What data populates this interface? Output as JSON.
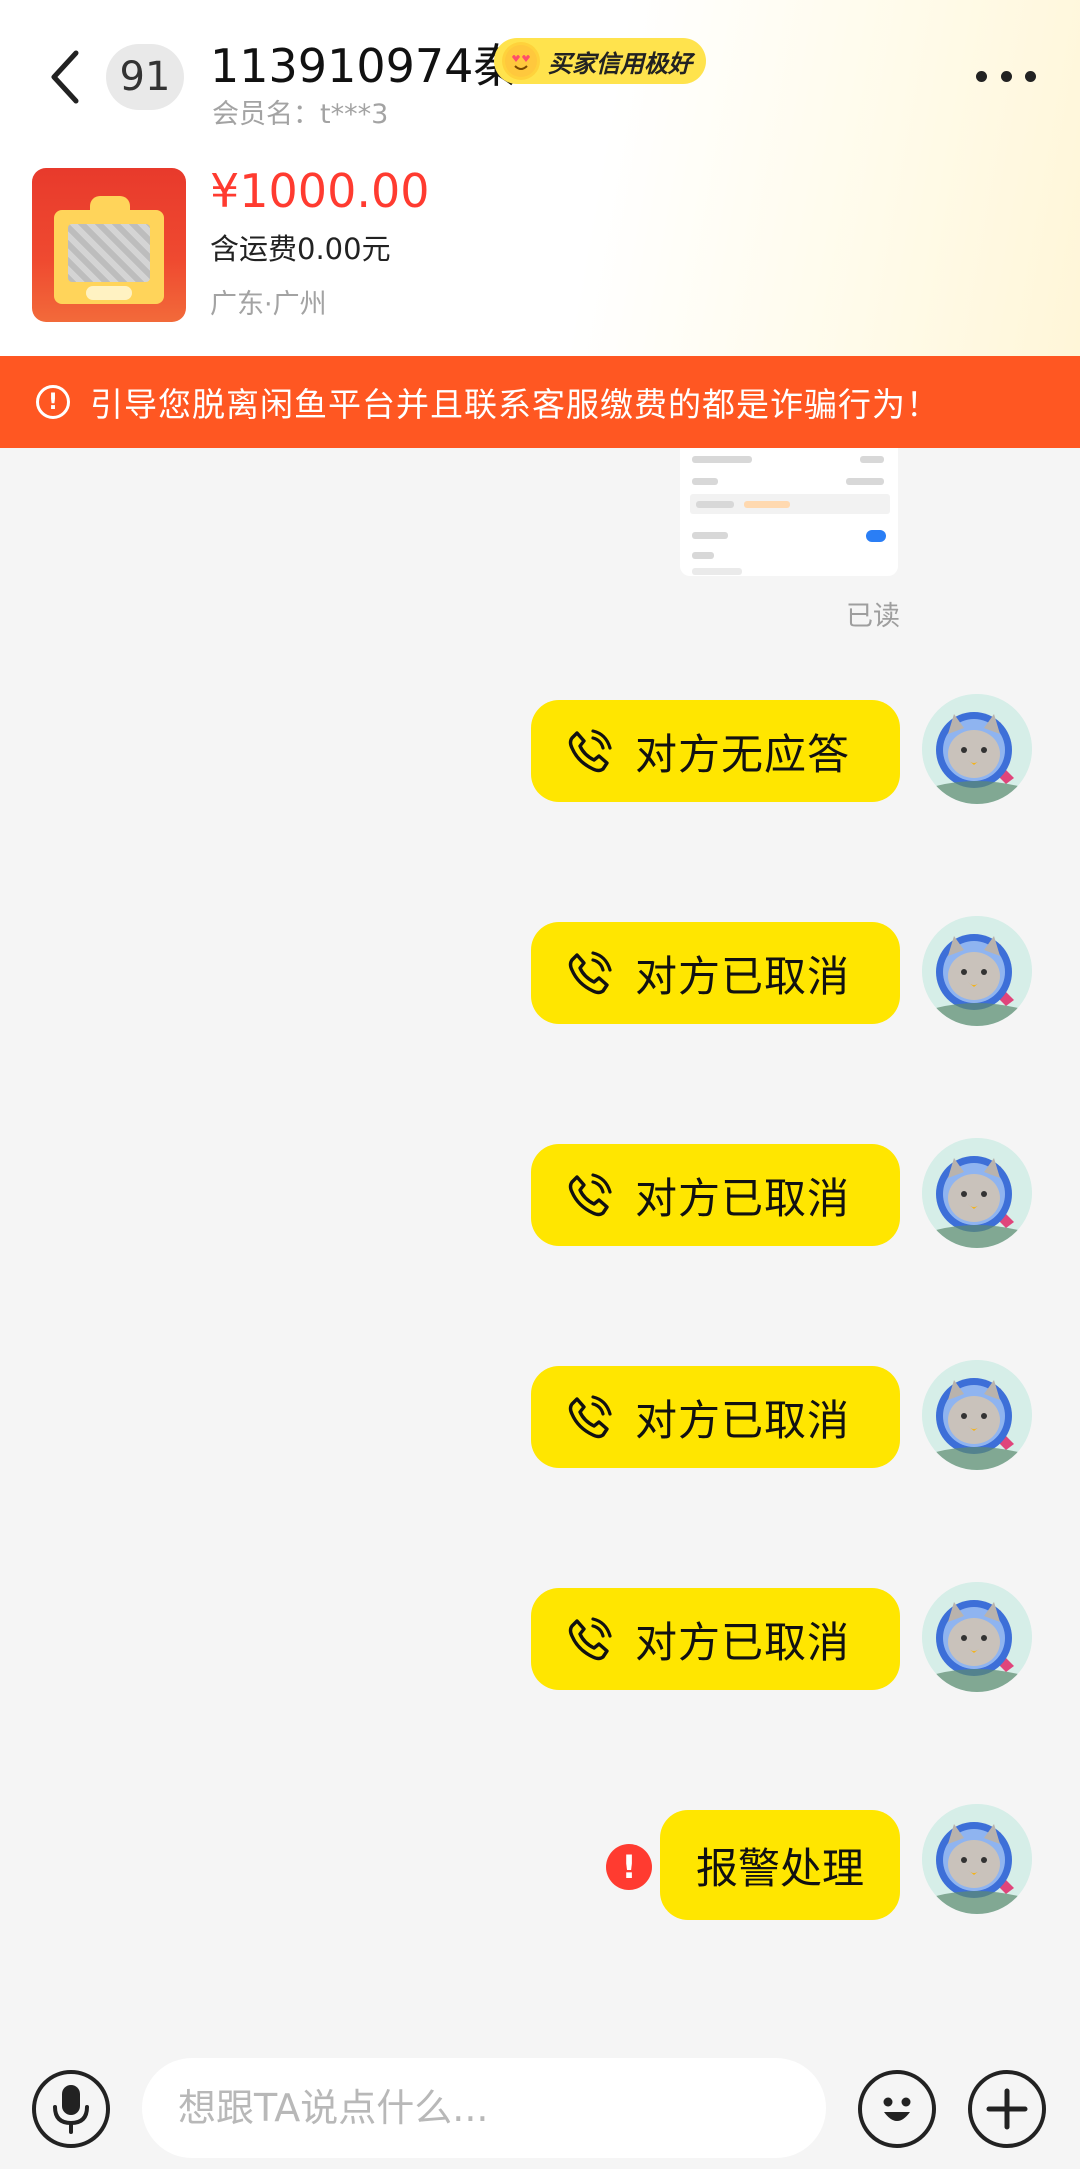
{
  "header": {
    "unread_count": "91",
    "nickname": "113910974秦",
    "credit_badge": "买家信用极好",
    "member_name": "会员名：t***3"
  },
  "product": {
    "price": "¥1000.00",
    "shipping": "含运费0.00元",
    "location": "广东·广州"
  },
  "warning": {
    "text": "引导您脱离闲鱼平台并且联系客服缴费的都是诈骗行为！"
  },
  "chat": {
    "read_status": "已读",
    "messages": [
      {
        "type": "call",
        "text": "对方无应答"
      },
      {
        "type": "call",
        "text": "对方已取消"
      },
      {
        "type": "call",
        "text": "对方已取消"
      },
      {
        "type": "call",
        "text": "对方已取消"
      },
      {
        "type": "call",
        "text": "对方已取消"
      },
      {
        "type": "text",
        "text": "报警处理",
        "failed": true
      }
    ]
  },
  "input": {
    "placeholder": "想跟TA说点什么..."
  },
  "colors": {
    "bubble": "#ffe600",
    "warning": "#ff5722",
    "price": "#ff3b30",
    "error": "#ff3b30"
  },
  "icons": [
    "back-icon",
    "more-icon",
    "alert-icon",
    "phone-call-icon",
    "error-icon",
    "microphone-icon",
    "emoji-icon",
    "plus-icon"
  ]
}
